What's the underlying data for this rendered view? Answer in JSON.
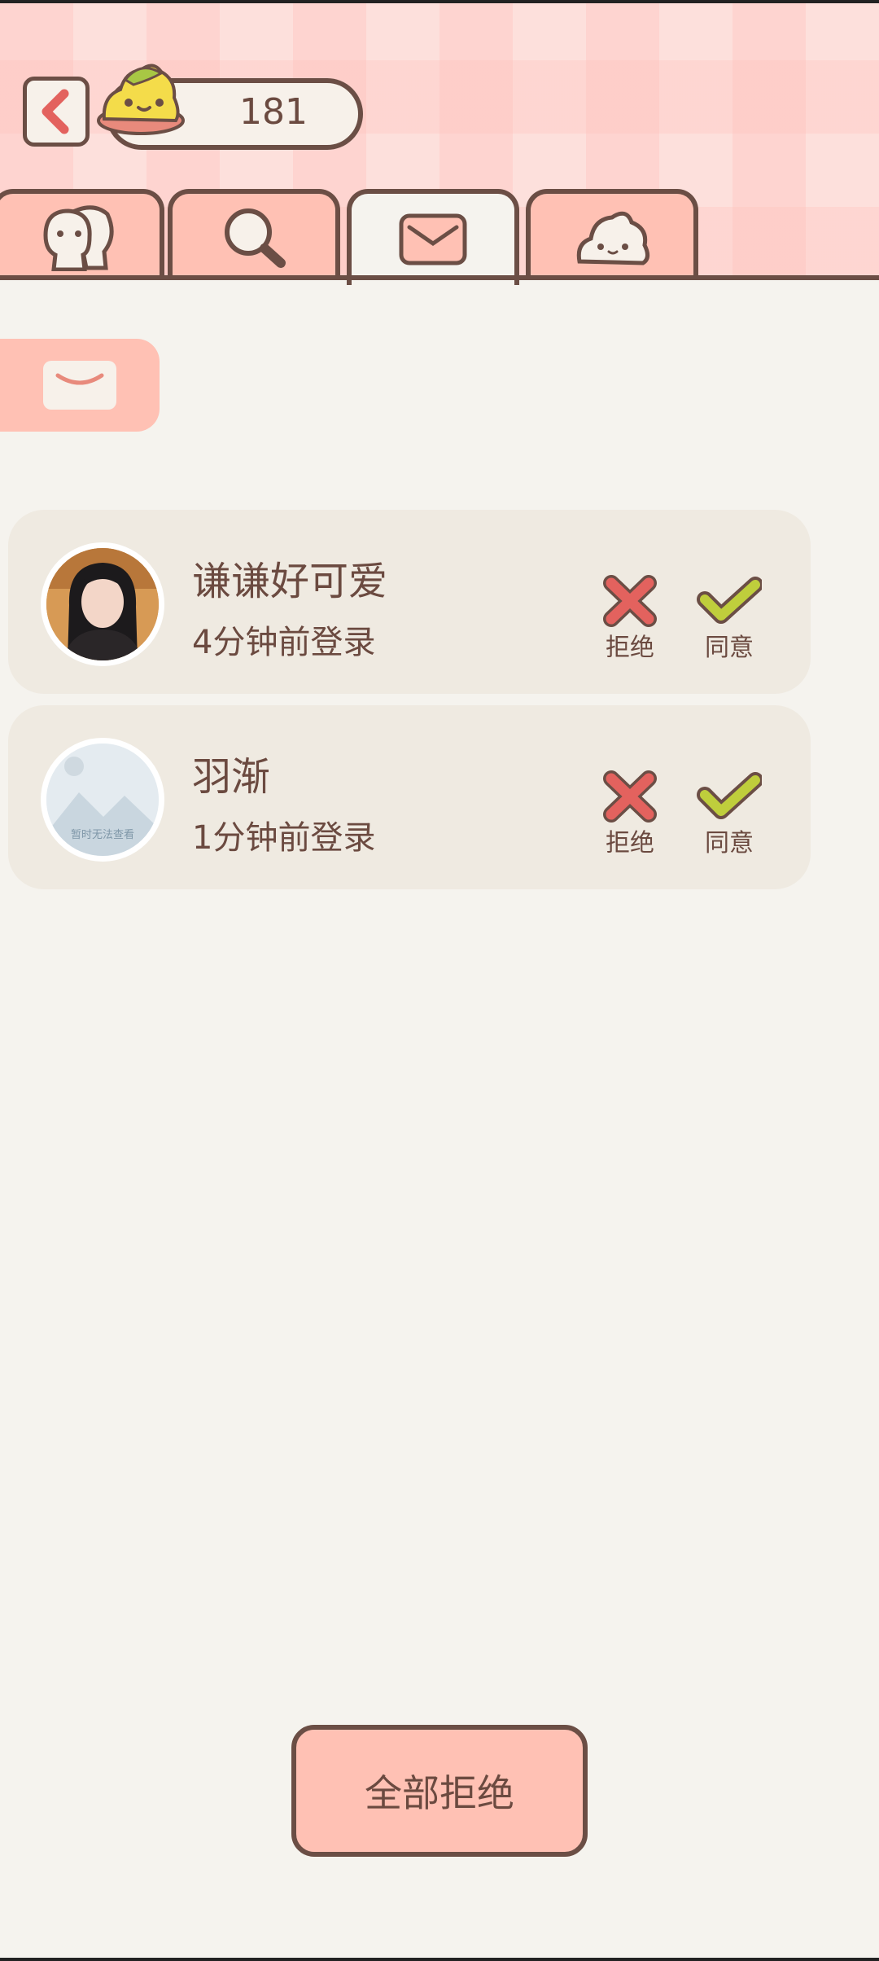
{
  "header": {
    "coin_count": "181"
  },
  "tabs": [
    {
      "icon": "friends-icon"
    },
    {
      "icon": "search-icon"
    },
    {
      "icon": "mail-icon",
      "active": true
    },
    {
      "icon": "mascot-icon"
    }
  ],
  "section_icon": "mail-icon",
  "requests": [
    {
      "name": "谦谦好可爱",
      "status": "4分钟前登录",
      "reject_label": "拒绝",
      "agree_label": "同意",
      "avatar": "photo"
    },
    {
      "name": "羽渐",
      "status": "1分钟前登录",
      "reject_label": "拒绝",
      "agree_label": "同意",
      "avatar": "placeholder",
      "avatar_text": "暂时无法查看"
    }
  ],
  "reject_all_label": "全部拒绝",
  "colors": {
    "accent": "#ffc1b4",
    "outline": "#6b4e45",
    "reject": "#e3625e",
    "agree": "#bfce3c",
    "background": "#f5f3ee"
  }
}
